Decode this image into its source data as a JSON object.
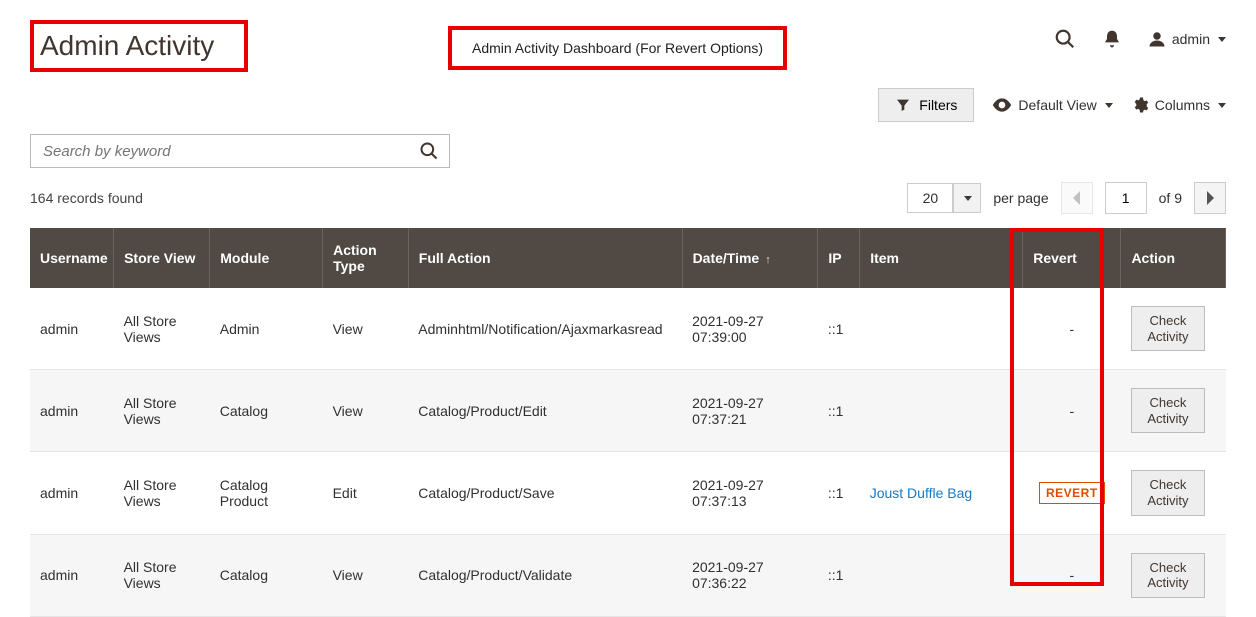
{
  "page": {
    "title": "Admin Activity",
    "annotation": "Admin Activity Dashboard (For Revert Options)"
  },
  "header": {
    "user_label": "admin"
  },
  "toolbar": {
    "filters_label": "Filters",
    "default_view_label": "Default View",
    "columns_label": "Columns"
  },
  "search": {
    "placeholder": "Search by keyword"
  },
  "meta": {
    "records_found": "164 records found",
    "per_page_value": "20",
    "per_page_label": "per page",
    "current_page": "1",
    "total_pages_label": "of 9"
  },
  "grid": {
    "columns": {
      "username": "Username",
      "store_view": "Store View",
      "module": "Module",
      "action_type": "Action Type",
      "full_action": "Full Action",
      "date_time": "Date/Time",
      "ip": "IP",
      "item": "Item",
      "revert": "Revert",
      "action": "Action"
    },
    "check_activity_label": "Check Activity",
    "revert_label": "REVERT",
    "rows": [
      {
        "username": "admin",
        "store_view": "All Store Views",
        "module": "Admin",
        "action_type": "View",
        "full_action": "Adminhtml/Notification/Ajaxmarkasread",
        "date_time": "2021-09-27 07:39:00",
        "ip": "::1",
        "item": "",
        "revert": "-"
      },
      {
        "username": "admin",
        "store_view": "All Store Views",
        "module": "Catalog",
        "action_type": "View",
        "full_action": "Catalog/Product/Edit",
        "date_time": "2021-09-27 07:37:21",
        "ip": "::1",
        "item": "",
        "revert": "-"
      },
      {
        "username": "admin",
        "store_view": "All Store Views",
        "module": "Catalog Product",
        "action_type": "Edit",
        "full_action": "Catalog/Product/Save",
        "date_time": "2021-09-27 07:37:13",
        "ip": "::1",
        "item": "Joust Duffle Bag",
        "revert": "REVERT"
      },
      {
        "username": "admin",
        "store_view": "All Store Views",
        "module": "Catalog",
        "action_type": "View",
        "full_action": "Catalog/Product/Validate",
        "date_time": "2021-09-27 07:36:22",
        "ip": "::1",
        "item": "",
        "revert": "-"
      }
    ]
  }
}
